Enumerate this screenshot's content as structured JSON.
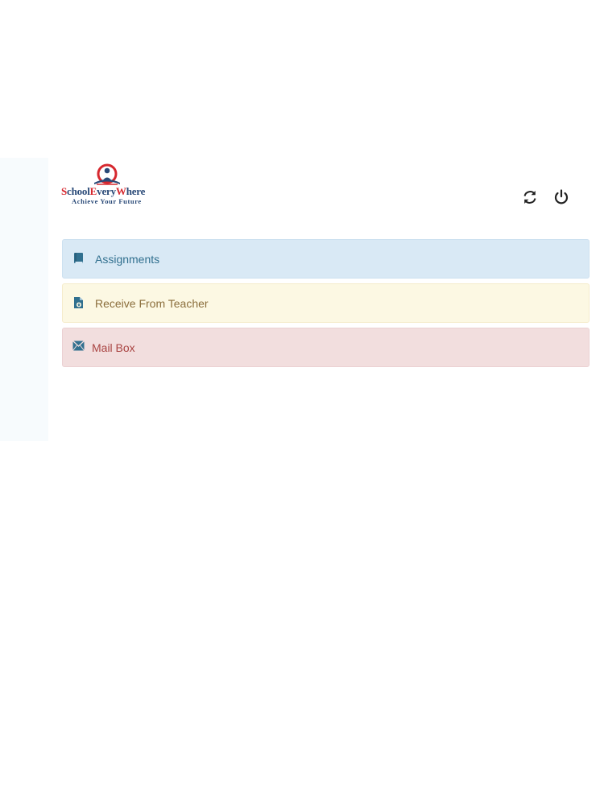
{
  "brand": {
    "name_parts": [
      "S",
      "chool",
      "E",
      "very",
      "W",
      "here"
    ],
    "tagline": "Achieve Your Future",
    "colors": {
      "red": "#d6282f",
      "blue": "#2a4a78"
    }
  },
  "toolbar": {
    "refresh_icon": "refresh-icon",
    "power_icon": "power-icon"
  },
  "menu": {
    "items": [
      {
        "label": "Assignments",
        "icon": "book-icon",
        "color": "#31708f"
      },
      {
        "label": "Receive From Teacher",
        "icon": "file-download-icon",
        "color": "#8a6d3b"
      },
      {
        "label": "Mail Box",
        "icon": "envelope-icon",
        "color": "#a94442"
      }
    ]
  }
}
